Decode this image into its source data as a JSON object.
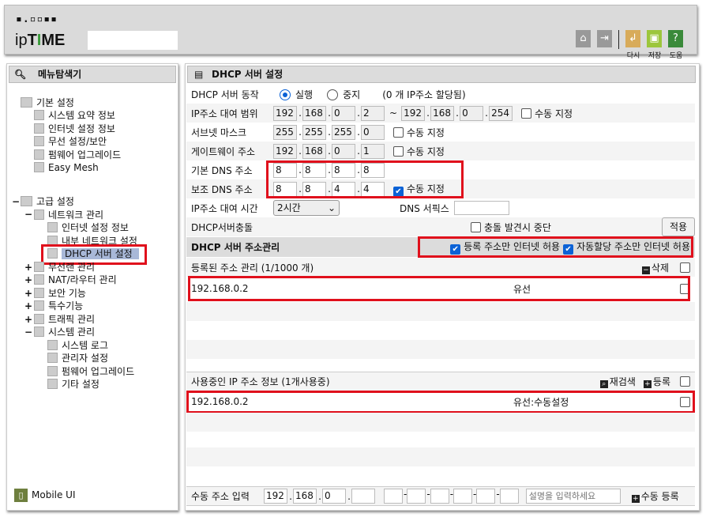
{
  "header": {
    "logo_dots": "▪.▫▫▪▪",
    "logo_text": {
      "ip": "ip",
      "T": "T",
      "I": "I",
      "ME": "ME"
    },
    "buttons": [
      {
        "icon": "home-icon"
      },
      {
        "icon": "logout-icon"
      },
      {
        "icon": "refresh-icon",
        "label": "다시"
      },
      {
        "icon": "save-icon",
        "label": "저장"
      },
      {
        "icon": "help-icon",
        "label": "도움"
      }
    ]
  },
  "sidebar": {
    "title": "메뉴탐색기",
    "basic": {
      "label": "기본 설정",
      "items": [
        "시스템 요약 정보",
        "인터넷 설정 정보",
        "무선 설정/보안",
        "펌웨어 업그레이드",
        "Easy Mesh"
      ]
    },
    "advanced": {
      "label": "고급 설정",
      "network": {
        "label": "네트워크 관리",
        "items": [
          "인터넷 설정 정보",
          "내부 네트워크 설정",
          "DHCP 서버 설정"
        ]
      },
      "groups": [
        "무선랜 관리",
        "NAT/라우터 관리",
        "보안 기능",
        "특수기능",
        "트래픽 관리"
      ],
      "system": {
        "label": "시스템 관리",
        "items": [
          "시스템 로그",
          "관리자 설정",
          "펌웨어 업그레이드",
          "기타 설정"
        ]
      }
    },
    "mobile": "Mobile UI"
  },
  "main": {
    "title": "DHCP 서버 설정",
    "op": {
      "label": "DHCP 서버 동작",
      "run": "실행",
      "stop": "중지",
      "status": "(0 개 IP주소 할당됨)",
      "selected": "run"
    },
    "range": {
      "label": "IP주소 대여 범위",
      "start": [
        "192",
        "168",
        "0",
        "2"
      ],
      "tilde": "~",
      "end": [
        "192",
        "168",
        "0",
        "254"
      ],
      "manual": "수동 지정"
    },
    "subnet": {
      "label": "서브넷 마스크",
      "value": [
        "255",
        "255",
        "255",
        "0"
      ],
      "manual": "수동 지정"
    },
    "gateway": {
      "label": "게이트웨이 주소",
      "value": [
        "192",
        "168",
        "0",
        "1"
      ],
      "manual": "수동 지정"
    },
    "dns1": {
      "label": "기본 DNS 주소",
      "value": [
        "8",
        "8",
        "8",
        "8"
      ]
    },
    "dns2": {
      "label": "보조 DNS 주소",
      "value": [
        "8",
        "8",
        "4",
        "4"
      ],
      "manual": "수동 지정"
    },
    "lease": {
      "label": "IP주소 대여 시간",
      "value": "2시간",
      "suffix_label": "DNS 서픽스",
      "suffix_value": ""
    },
    "conflict": {
      "label": "DHCP서버충돌",
      "option": "충돌 발견시 중단",
      "apply": "적용"
    },
    "mgmt": {
      "title": "DHCP 서버 주소관리",
      "opt1": "등록 주소만 인터넷 허용",
      "opt2": "자동할당 주소만 인터넷 허용"
    },
    "registered": {
      "title": "등록된 주소 관리 (1/1000 개)",
      "delete": "삭제",
      "rows": [
        {
          "ip": "192.168.0.2",
          "type": "유선"
        }
      ]
    },
    "inuse": {
      "title": "사용중인 IP 주소 정보 (1개사용중)",
      "rescan": "재검색",
      "register": "등록",
      "rows": [
        {
          "ip": "192.168.0.2",
          "type": "유선:수동설정"
        }
      ]
    },
    "manual": {
      "label": "수동 주소 입력",
      "ip": [
        "192",
        "168",
        "0",
        ""
      ],
      "desc_placeholder": "설명을 입력하세요",
      "register": "수동 등록"
    }
  }
}
